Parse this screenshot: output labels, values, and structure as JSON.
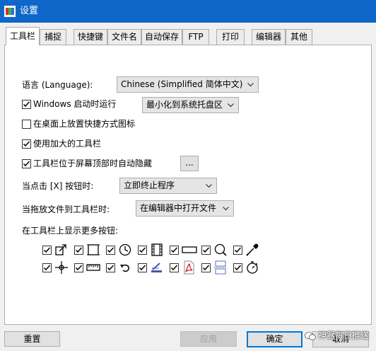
{
  "window": {
    "title": "设置",
    "accent": "#0f67c9"
  },
  "tabs": [
    {
      "label": "工具栏",
      "active": true
    },
    {
      "label": "捕捉"
    },
    {
      "label": "快捷键"
    },
    {
      "label": "文件名"
    },
    {
      "label": "自动保存"
    },
    {
      "label": "FTP"
    },
    {
      "label": "打印"
    },
    {
      "label": "编辑器"
    },
    {
      "label": "其他"
    }
  ],
  "toolbar_tab": {
    "language_label": "语言 (Language):",
    "language_value": "Chinese (Simplified 简体中文)",
    "windows_startup": {
      "label": "Windows 启动时运行",
      "checked": true
    },
    "startup_mode_value": "最小化到系统托盘区",
    "desktop_shortcut": {
      "label": "在桌面上放置快捷方式图标",
      "checked": false
    },
    "large_toolbar": {
      "label": "使用加大的工具栏",
      "checked": true
    },
    "autohide_toolbar": {
      "label": "工具栏位于屏幕顶部时自动隐藏",
      "checked": true
    },
    "more_button_label": "...",
    "close_action_label": "当点击 [X] 按钮时:",
    "close_action_value": "立即终止程序",
    "drag_drop_label": "当拖放文件到工具栏时:",
    "drag_drop_value": "在编辑器中打开文件",
    "more_buttons_label": "在工具栏上显示更多按钮:",
    "tool_rows": [
      [
        {
          "icon": "arrow-export-icon",
          "checked": true
        },
        {
          "icon": "rectangle-capture-icon",
          "checked": true
        },
        {
          "icon": "clock-icon",
          "checked": true
        },
        {
          "icon": "film-strip-icon",
          "checked": true
        },
        {
          "icon": "scrolling-window-icon",
          "checked": true
        },
        {
          "icon": "magnifier-icon",
          "checked": true
        },
        {
          "icon": "color-picker-icon",
          "checked": true
        }
      ],
      [
        {
          "icon": "crosshair-icon",
          "checked": true
        },
        {
          "icon": "ruler-icon",
          "checked": true
        },
        {
          "icon": "undo-arrow-icon",
          "checked": true
        },
        {
          "icon": "scanner-icon",
          "checked": true
        },
        {
          "icon": "pdf-icon",
          "checked": true
        },
        {
          "icon": "page-split-icon",
          "checked": true
        },
        {
          "icon": "stopwatch-icon",
          "checked": true
        }
      ]
    ]
  },
  "footer": {
    "reset_label": "重置",
    "apply_label": "应用",
    "ok_label": "确定",
    "cancel_label": "取消"
  },
  "watermark": {
    "text": "神器每日推送"
  }
}
